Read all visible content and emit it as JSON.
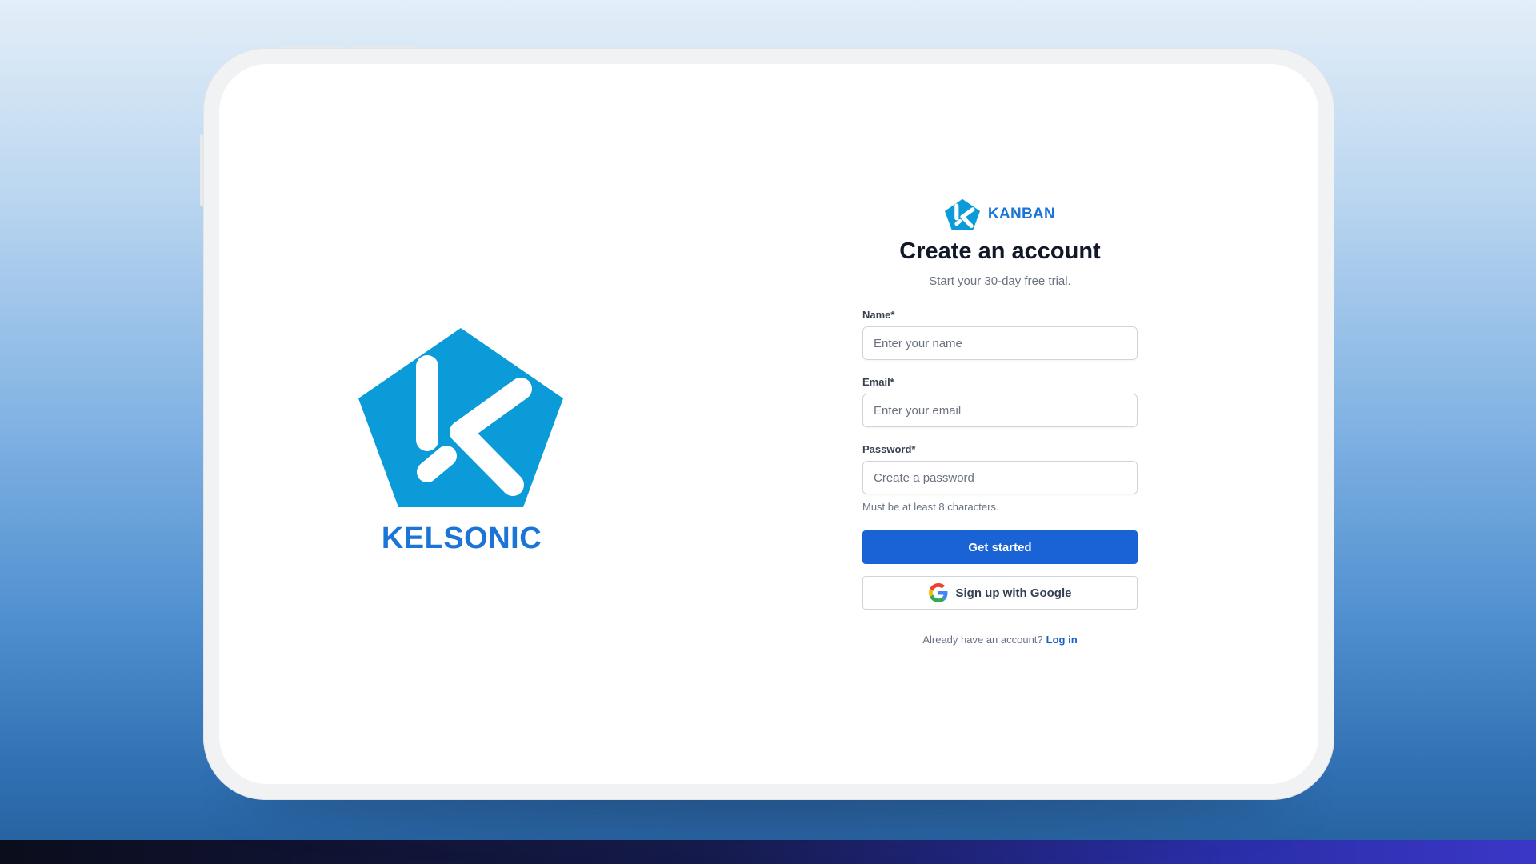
{
  "brand": {
    "name": "KELSONIC",
    "color": "#1b75d6",
    "logo_color": "#0a9bd8"
  },
  "app": {
    "name": "KANBAN"
  },
  "form": {
    "title": "Create an account",
    "subtitle": "Start your 30-day free trial.",
    "fields": {
      "name": {
        "label": "Name*",
        "placeholder": "Enter your name",
        "value": ""
      },
      "email": {
        "label": "Email*",
        "placeholder": "Enter your email",
        "value": ""
      },
      "password": {
        "label": "Password*",
        "placeholder": "Create a password",
        "value": "",
        "hint": "Must be at least 8 characters."
      }
    },
    "primary_button": "Get started",
    "google_button": "Sign up with Google",
    "login_prompt": "Already have an account?",
    "login_link": "Log in",
    "accent_color": "#1a63d6"
  },
  "icons": {
    "brand_logo": "kelsonic-pentagon-k-logo",
    "app_logo": "kanban-pentagon-k-logo",
    "google": "google-g-icon"
  }
}
